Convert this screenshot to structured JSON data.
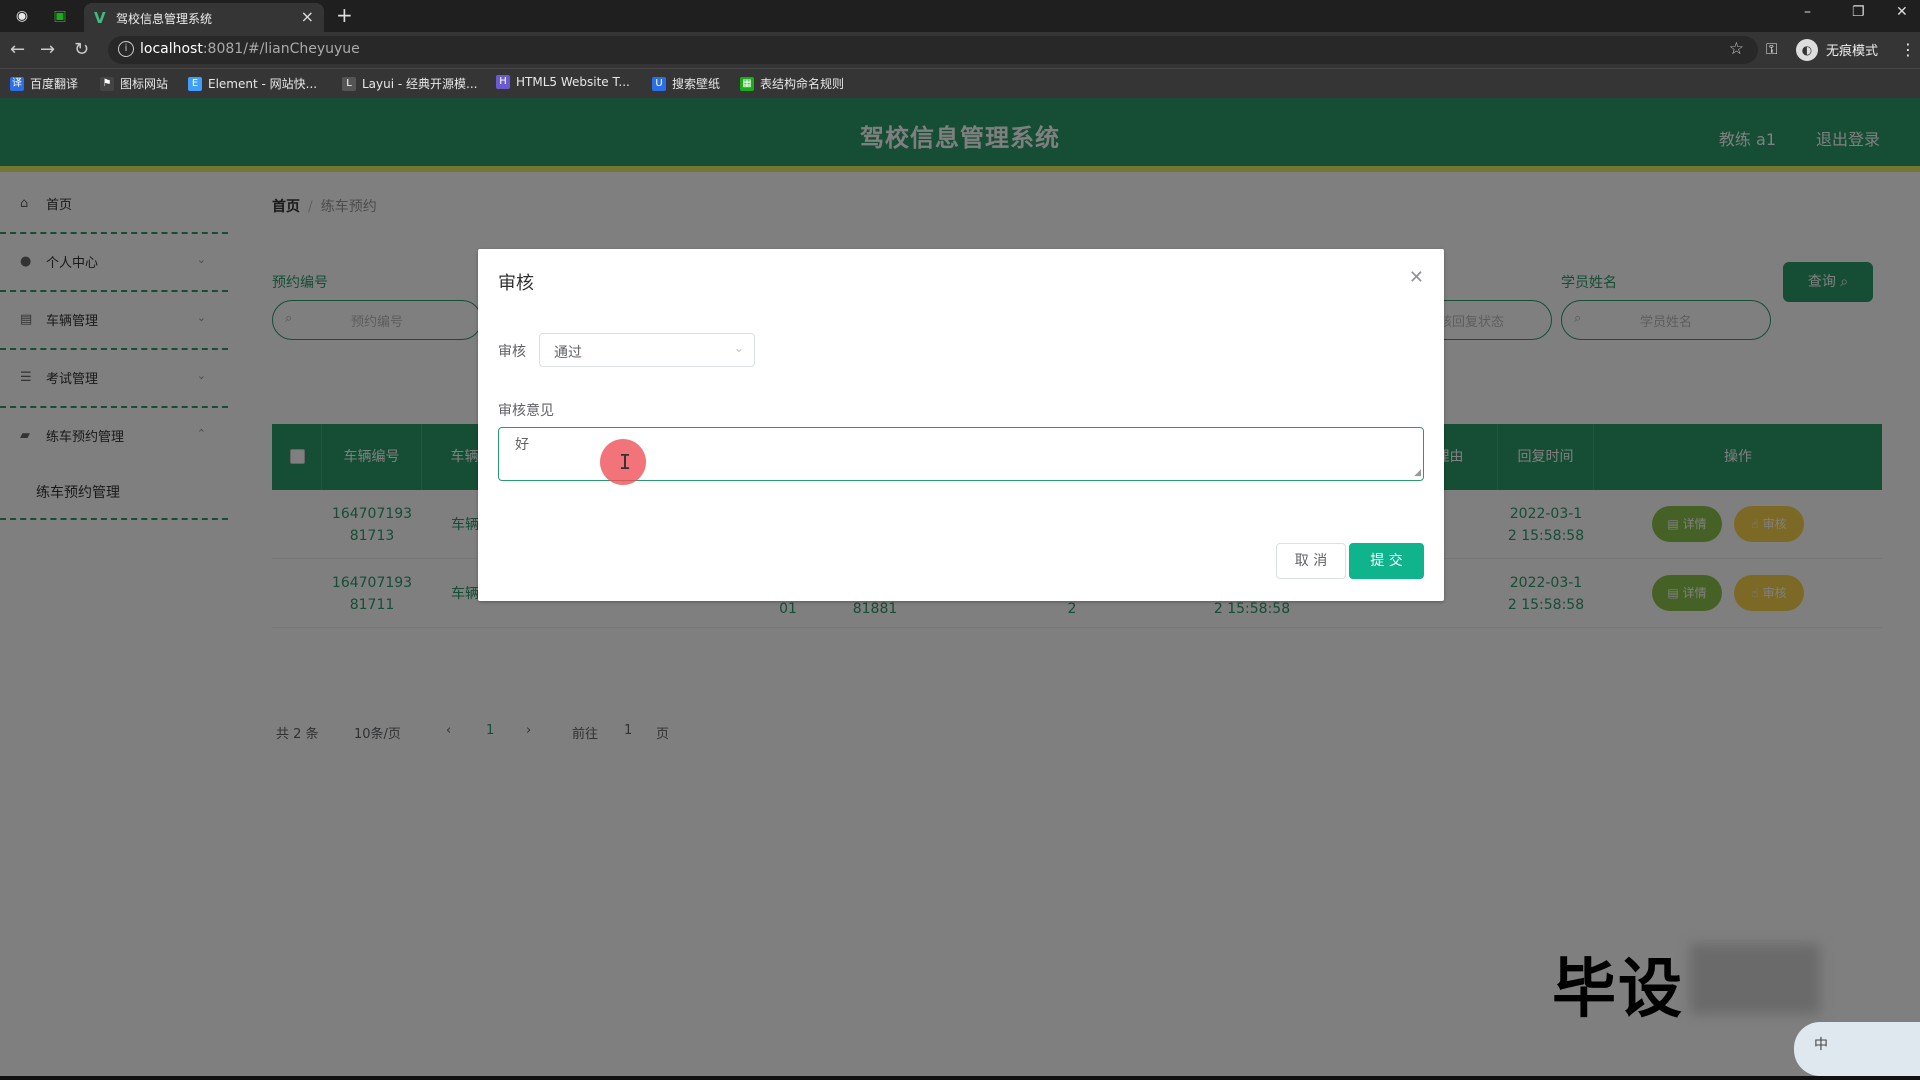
{
  "browser": {
    "tab_title": "驾校信息管理系统",
    "url_host": "localhost",
    "url_path": ":8081/#/lianCheyuyue",
    "incognito_label": "无痕模式",
    "bookmarks": [
      {
        "label": "百度翻译",
        "color": "#2b6fe6"
      },
      {
        "label": "图标网站",
        "color": "#444444"
      },
      {
        "label": "Element - 网站快...",
        "color": "#409eff"
      },
      {
        "label": "Layui - 经典开源模...",
        "color": "#555555"
      },
      {
        "label": "HTML5 Website T...",
        "color": "#6a5acd"
      },
      {
        "label": "搜索壁纸",
        "color": "#2b6fe6"
      },
      {
        "label": "表结构命名规则",
        "color": "#1aad19"
      }
    ]
  },
  "header": {
    "title": "驾校信息管理系统",
    "user": "教练 a1",
    "logout": "退出登录"
  },
  "sidebar": {
    "items": [
      {
        "label": "首页",
        "icon": "home-icon"
      },
      {
        "label": "个人中心",
        "icon": "user-icon"
      },
      {
        "label": "车辆管理",
        "icon": "car-icon"
      },
      {
        "label": "考试管理",
        "icon": "list-icon"
      },
      {
        "label": "练车预约管理",
        "icon": "folder-icon"
      }
    ],
    "sub_item": "练车预约管理"
  },
  "breadcrumb": {
    "home": "首页",
    "separator": "/",
    "current": "练车预约"
  },
  "search": {
    "field1_label": "预约编号",
    "field1_placeholder": "预约编号",
    "field2_label": "学员姓名",
    "field2_placeholder": "学员姓名",
    "field_mid_placeholder": "审核回复状态",
    "query_button": "查询"
  },
  "table": {
    "headers": [
      "车辆编号",
      "车辆名",
      "理由",
      "回复时间",
      "操作"
    ],
    "rows": [
      {
        "code_line1": "164707193",
        "code_line2": "81713",
        "name": "车辆名",
        "time_line1": "2022-03-1",
        "time_line2": "2 15:58:58",
        "detail": "详情",
        "audit": "审核"
      },
      {
        "code_line1": "164707193",
        "code_line2": "81711",
        "name": "车辆名",
        "extra1": "01",
        "extra2": "81881",
        "extra3": "2",
        "extra4": "2 15:58:58",
        "time_line1": "2022-03-1",
        "time_line2": "2 15:58:58",
        "detail": "详情",
        "audit": "审核"
      }
    ]
  },
  "pager": {
    "total": "共 2 条",
    "size": "10条/页",
    "prev": "‹",
    "page": "1",
    "next": "›",
    "goto": "前往",
    "goto_value": "1",
    "page_suffix": "页"
  },
  "modal": {
    "title": "审核",
    "status_label": "审核",
    "status_value": "通过",
    "opinion_label": "审核意见",
    "opinion_value": "好",
    "cancel": "取 消",
    "submit": "提 交"
  },
  "watermark": {
    "text": "毕设",
    "ime": "中"
  },
  "colors": {
    "primary": "#2a9a6a",
    "header_accent": "#e9ee64",
    "submit": "#0fb48d",
    "detail_btn": "#8bc34a",
    "audit_btn": "#f7d34b"
  }
}
